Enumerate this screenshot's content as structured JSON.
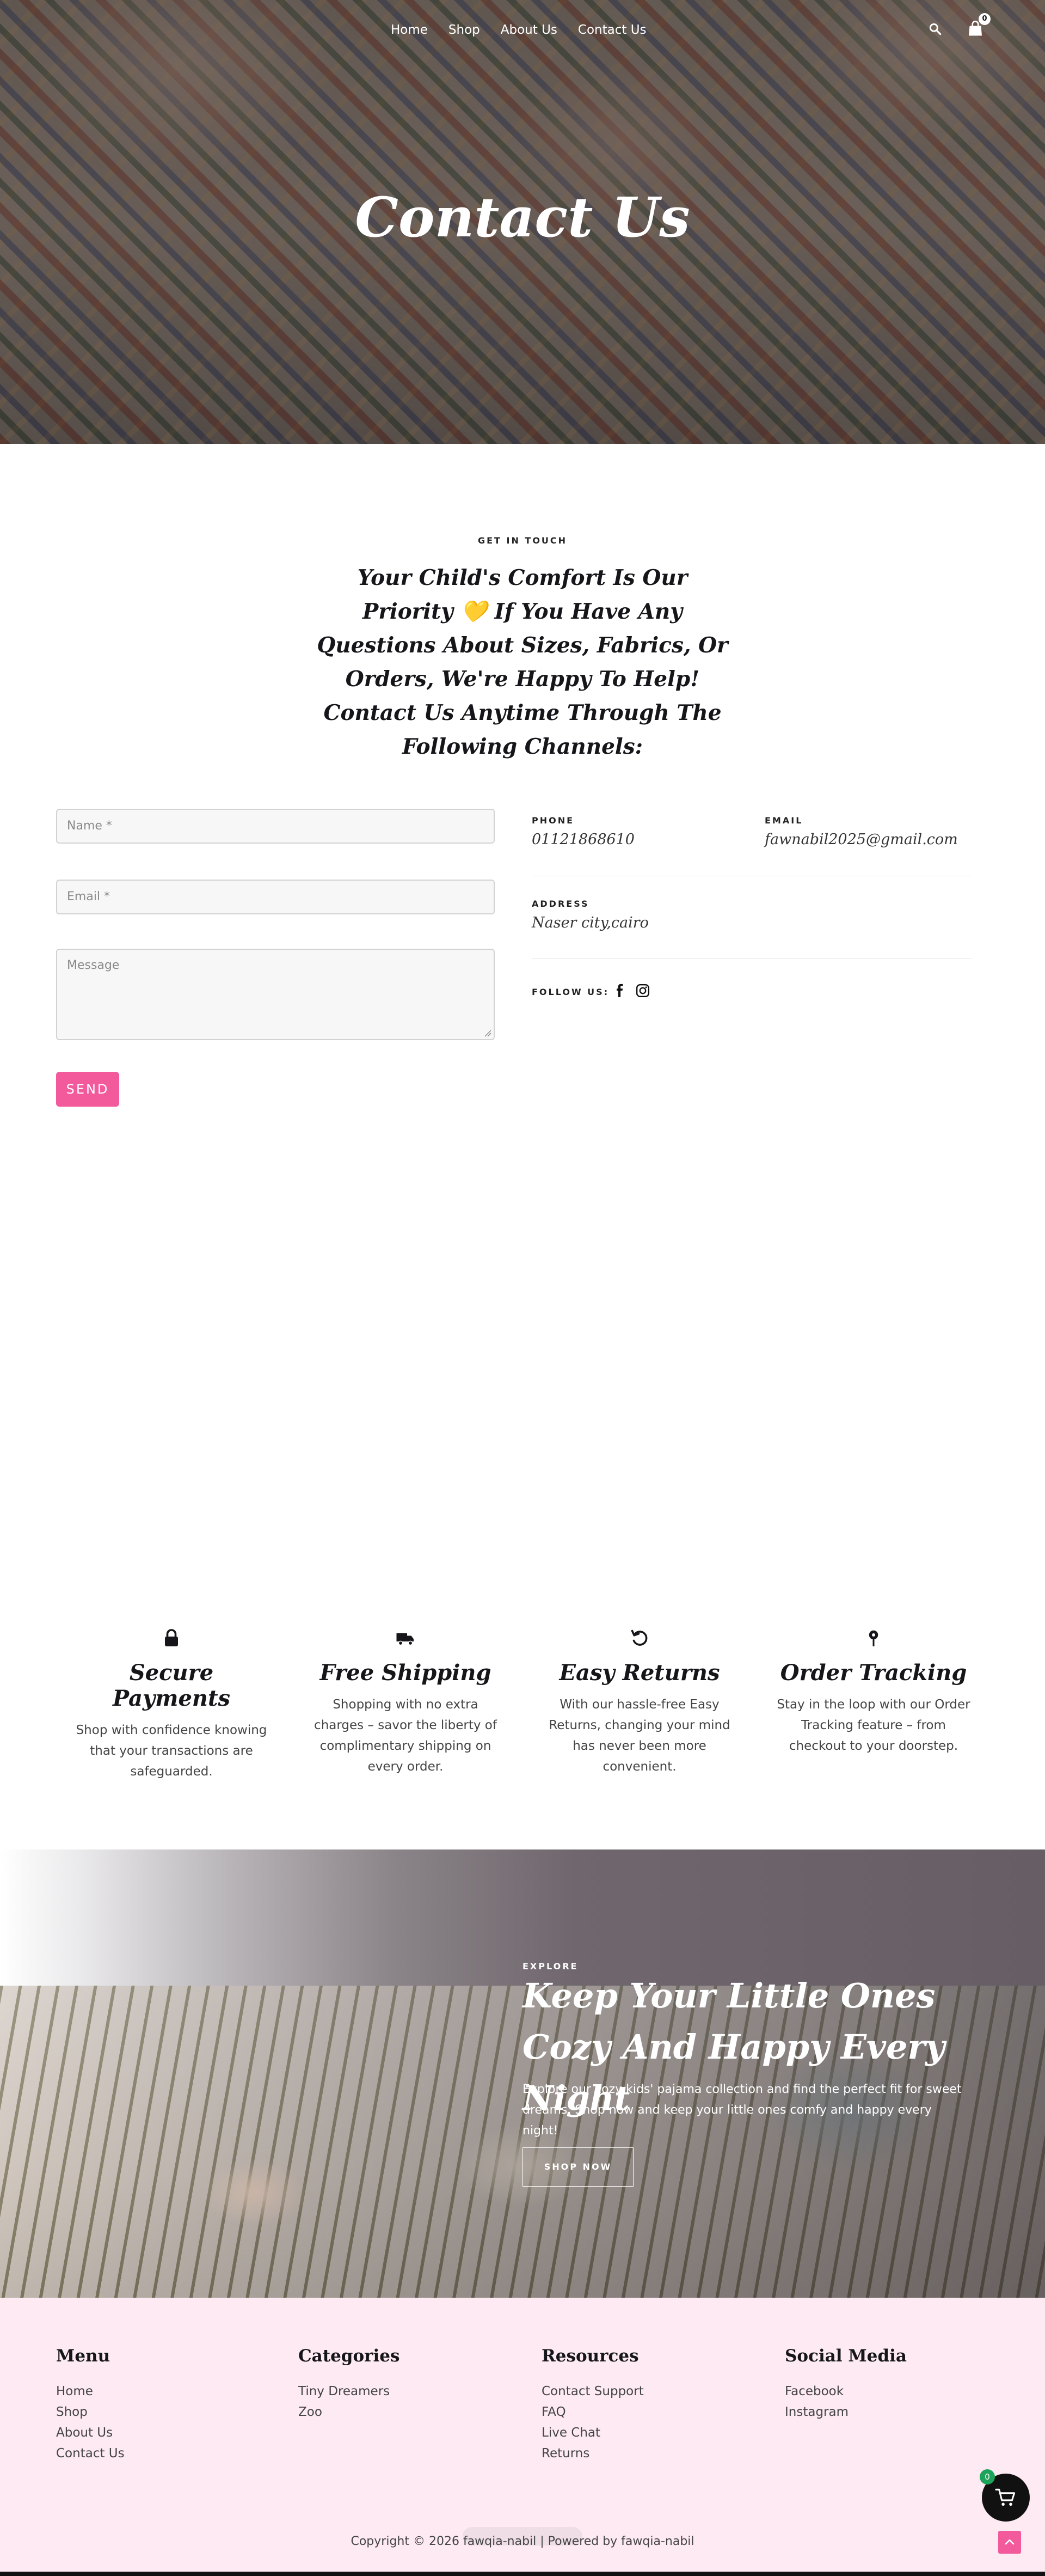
{
  "nav": {
    "links": [
      "Home",
      "Shop",
      "About Us",
      "Contact Us"
    ],
    "cart_count": "0"
  },
  "hero": {
    "title": "Contact Us"
  },
  "contact": {
    "eyebrow": "GET IN TOUCH",
    "intro": "Your Child's Comfort Is Our Priority 💛 If You Have Any Questions About Sizes, Fabrics, Or Orders, We're Happy To Help! Contact Us Anytime Through The Following Channels:"
  },
  "form": {
    "name_placeholder": "Name *",
    "email_placeholder": "Email *",
    "message_placeholder": "Message",
    "send_label": "SEND"
  },
  "info": {
    "phone_label": "PHONE",
    "phone_value": "01121868610",
    "email_label": "EMAIL",
    "email_value": "fawnabil2025@gmail.com",
    "address_label": "ADDRESS",
    "address_value": "Naser city,cairo",
    "follow_label": "FOLLOW US:"
  },
  "features": [
    {
      "icon": "lock-icon",
      "title": "Secure Payments",
      "text": "Shop with confidence knowing that your transactions are safeguarded."
    },
    {
      "icon": "truck-icon",
      "title": "Free Shipping",
      "text": "Shopping with no extra charges – savor the liberty of complimentary shipping on every order."
    },
    {
      "icon": "return-icon",
      "title": "Easy Returns",
      "text": "With our hassle-free Easy Returns, changing your mind has never been more convenient."
    },
    {
      "icon": "location-pin-icon",
      "title": "Order Tracking",
      "text": "Stay in the loop with our Order Tracking feature – from checkout to your doorstep."
    }
  ],
  "promo": {
    "eyebrow": "EXPLORE",
    "title": "Keep Your Little Ones Cozy And Happy Every Night",
    "text": "Explore our cozy kids' pajama collection and find the perfect fit for sweet dreams. Shop now and keep your little ones comfy and happy every night!",
    "button": "SHOP NOW"
  },
  "footer": {
    "columns": [
      {
        "title": "Menu",
        "links": [
          "Home",
          "Shop",
          "About Us",
          "Contact Us"
        ]
      },
      {
        "title": "Categories",
        "links": [
          "Tiny Dreamers",
          "Zoo"
        ]
      },
      {
        "title": "Resources",
        "links": [
          "Contact Support",
          "FAQ",
          "Live Chat",
          "Returns"
        ]
      },
      {
        "title": "Social Media",
        "links": [
          "Facebook",
          "Instagram"
        ]
      }
    ],
    "copyright": "Copyright © 2026 fawqia-nabil | Powered by fawqia-nabil",
    "float_cart_count": "0"
  },
  "colors": {
    "accent_pink": "#f25a9b",
    "footer_bg": "#fdeaf2",
    "heading": "#15151a"
  }
}
